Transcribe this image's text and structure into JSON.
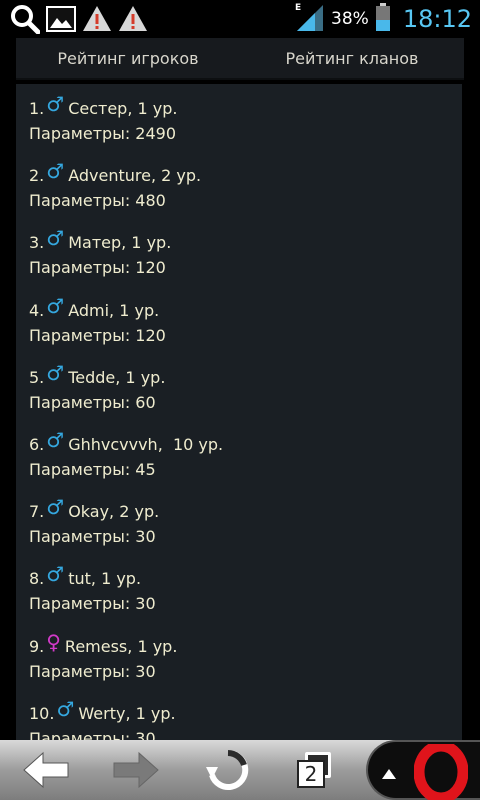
{
  "status_bar": {
    "battery": "38%",
    "time": "18:12",
    "network_type": "E",
    "icons": [
      "search-icon",
      "image-icon",
      "warning-icon",
      "warning-icon",
      "signal-icon",
      "battery-icon"
    ]
  },
  "tabs": [
    {
      "label": "Рейтинг игроков"
    },
    {
      "label": "Рейтинг кланов"
    }
  ],
  "players": [
    {
      "rank": "1.",
      "gender": "male",
      "name_level": "Сестер, 1 ур.",
      "params": "Параметры: 2490"
    },
    {
      "rank": "2.",
      "gender": "male",
      "name_level": "Adventure, 2 ур.",
      "params": "Параметры: 480"
    },
    {
      "rank": "3.",
      "gender": "male",
      "name_level": "Матер, 1 ур.",
      "params": "Параметры: 120"
    },
    {
      "rank": "4.",
      "gender": "male",
      "name_level": "Admi, 1 ур.",
      "params": "Параметры: 120"
    },
    {
      "rank": "5.",
      "gender": "male",
      "name_level": "Tedde, 1 ур.",
      "params": "Параметры: 60"
    },
    {
      "rank": "6.",
      "gender": "male",
      "name_level": "Ghhvcvvvh,  10 ур.",
      "params": "Параметры: 45"
    },
    {
      "rank": "7.",
      "gender": "male",
      "name_level": "Okay, 2 ур.",
      "params": "Параметры: 30"
    },
    {
      "rank": "8.",
      "gender": "male",
      "name_level": "tut, 1 ур.",
      "params": "Параметры: 30"
    },
    {
      "rank": "9.",
      "gender": "female",
      "name_level": "Remess, 1 ур.",
      "params": "Параметры: 30"
    },
    {
      "rank": "10.",
      "gender": "male",
      "name_level": "Werty, 1 ур.",
      "params": "Параметры: 30"
    }
  ],
  "gender_symbols": {
    "male": "♂",
    "female": "♀"
  },
  "navbar": {
    "tabs_count": "2",
    "icons": [
      "back-arrow-icon",
      "forward-arrow-icon",
      "reload-icon",
      "tabs-icon",
      "menu-up-icon",
      "opera-logo-icon"
    ]
  },
  "colors": {
    "clock": "#58c7f3",
    "male": "#35a8e0",
    "female": "#d23ac9",
    "opera_red": "#e0141b"
  }
}
